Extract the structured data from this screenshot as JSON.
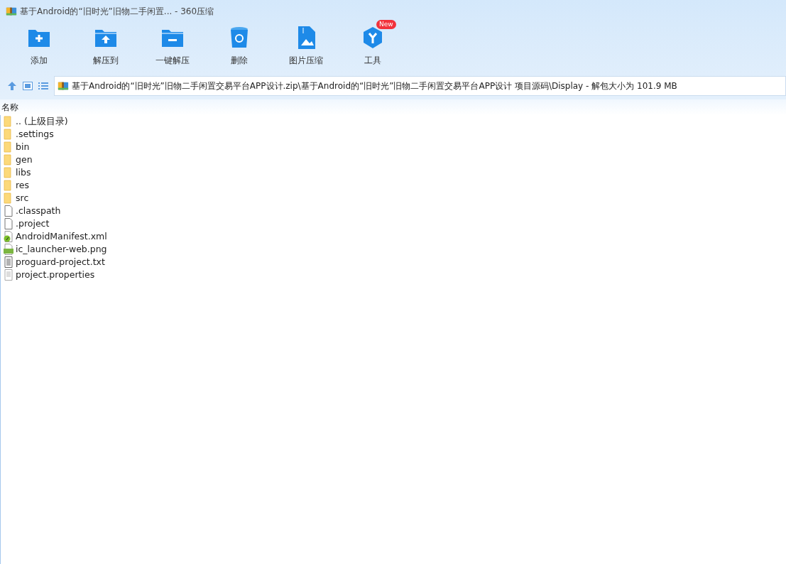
{
  "window": {
    "title": "基于Android的“旧时光”旧物二手闲置... - 360压缩"
  },
  "toolbar": [
    {
      "label": "添加",
      "kind": "add"
    },
    {
      "label": "解压到",
      "kind": "extract"
    },
    {
      "label": "一键解压",
      "kind": "quick"
    },
    {
      "label": "删除",
      "kind": "delete"
    },
    {
      "label": "图片压缩",
      "kind": "image"
    },
    {
      "label": "工具",
      "kind": "tools",
      "badge": "New"
    }
  ],
  "address": {
    "path": "基于Android的“旧时光”旧物二手闲置交易平台APP设计.zip\\基于Android的“旧时光”旧物二手闲置交易平台APP设计 项目源码\\Display - 解包大小为 101.9 MB"
  },
  "table": {
    "columns": [
      "名称"
    ],
    "rows": [
      {
        "name": ".. (上级目录)",
        "kind": "folder"
      },
      {
        "name": ".settings",
        "kind": "folder"
      },
      {
        "name": "bin",
        "kind": "folder"
      },
      {
        "name": "gen",
        "kind": "folder"
      },
      {
        "name": "libs",
        "kind": "folder"
      },
      {
        "name": "res",
        "kind": "folder"
      },
      {
        "name": "src",
        "kind": "folder"
      },
      {
        "name": ".classpath",
        "kind": "file"
      },
      {
        "name": ".project",
        "kind": "file"
      },
      {
        "name": "AndroidManifest.xml",
        "kind": "xml"
      },
      {
        "name": "ic_launcher-web.png",
        "kind": "png"
      },
      {
        "name": "proguard-project.txt",
        "kind": "text"
      },
      {
        "name": "project.properties",
        "kind": "text-light"
      }
    ]
  }
}
